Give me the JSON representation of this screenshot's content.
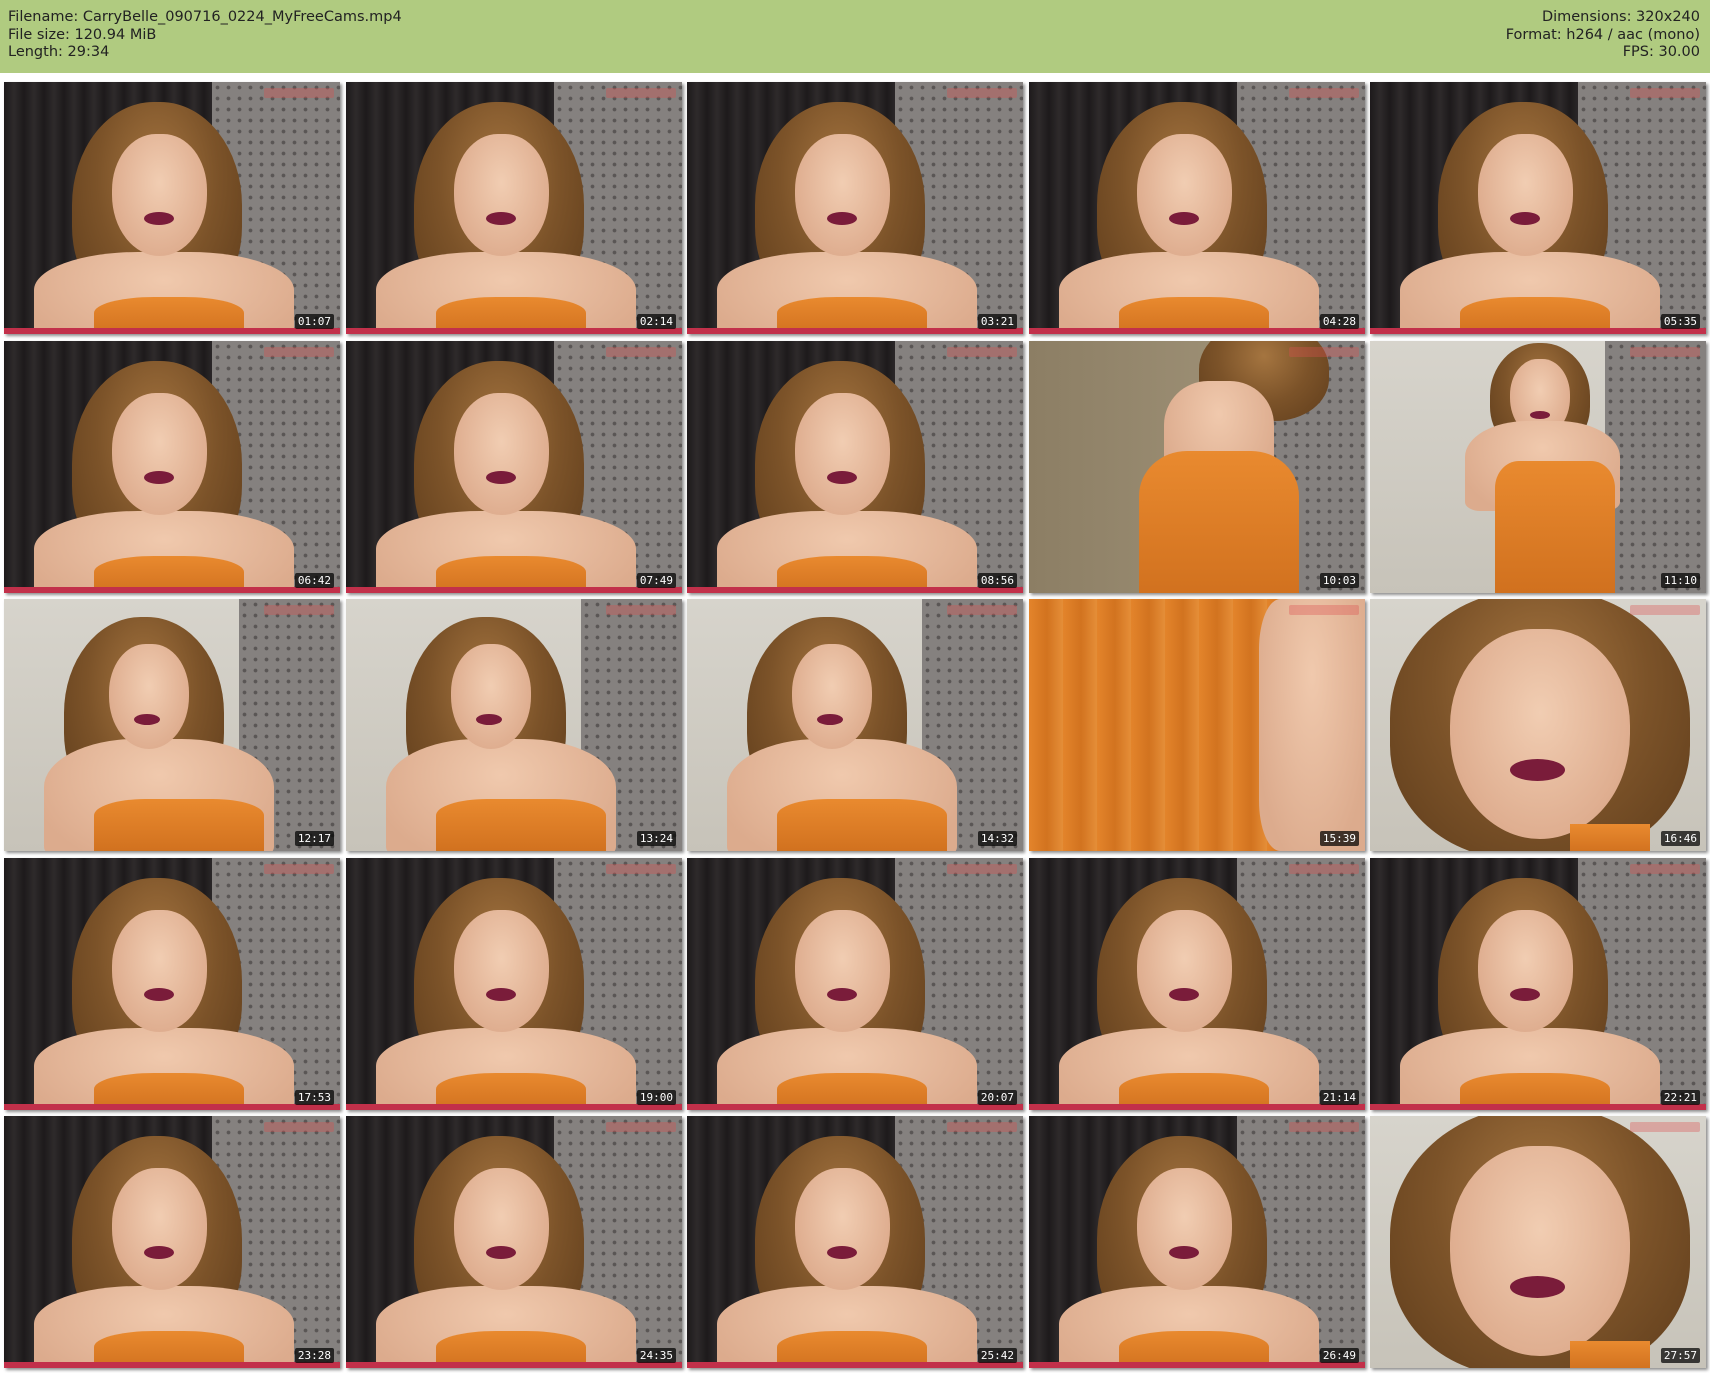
{
  "header": {
    "filename_label": "Filename: CarryBelle_090716_0224_MyFreeCams.mp4",
    "filesize_label": "File size: 120.94 MiB",
    "length_label": "Length: 29:34",
    "dimensions_label": "Dimensions: 320x240",
    "format_label": "Format: h264 / aac (mono)",
    "fps_label": "FPS: 30.00",
    "background_color": "#b0cb80"
  },
  "thumbnails": [
    {
      "time": "01:07",
      "scene": "curtain"
    },
    {
      "time": "02:14",
      "scene": "curtain"
    },
    {
      "time": "03:21",
      "scene": "curtain"
    },
    {
      "time": "04:28",
      "scene": "curtain"
    },
    {
      "time": "05:35",
      "scene": "curtain"
    },
    {
      "time": "06:42",
      "scene": "curtain"
    },
    {
      "time": "07:49",
      "scene": "curtain"
    },
    {
      "time": "08:56",
      "scene": "curtain"
    },
    {
      "time": "10:03",
      "scene": "dress-back"
    },
    {
      "time": "11:10",
      "scene": "standing"
    },
    {
      "time": "12:17",
      "scene": "room"
    },
    {
      "time": "13:24",
      "scene": "room"
    },
    {
      "time": "14:32",
      "scene": "room"
    },
    {
      "time": "15:39",
      "scene": "dress-close"
    },
    {
      "time": "16:46",
      "scene": "closeup"
    },
    {
      "time": "17:53",
      "scene": "curtain"
    },
    {
      "time": "19:00",
      "scene": "curtain"
    },
    {
      "time": "20:07",
      "scene": "curtain"
    },
    {
      "time": "21:14",
      "scene": "curtain"
    },
    {
      "time": "22:21",
      "scene": "curtain"
    },
    {
      "time": "23:28",
      "scene": "curtain"
    },
    {
      "time": "24:35",
      "scene": "curtain"
    },
    {
      "time": "25:42",
      "scene": "curtain"
    },
    {
      "time": "26:49",
      "scene": "curtain"
    },
    {
      "time": "27:57",
      "scene": "closeup"
    }
  ]
}
